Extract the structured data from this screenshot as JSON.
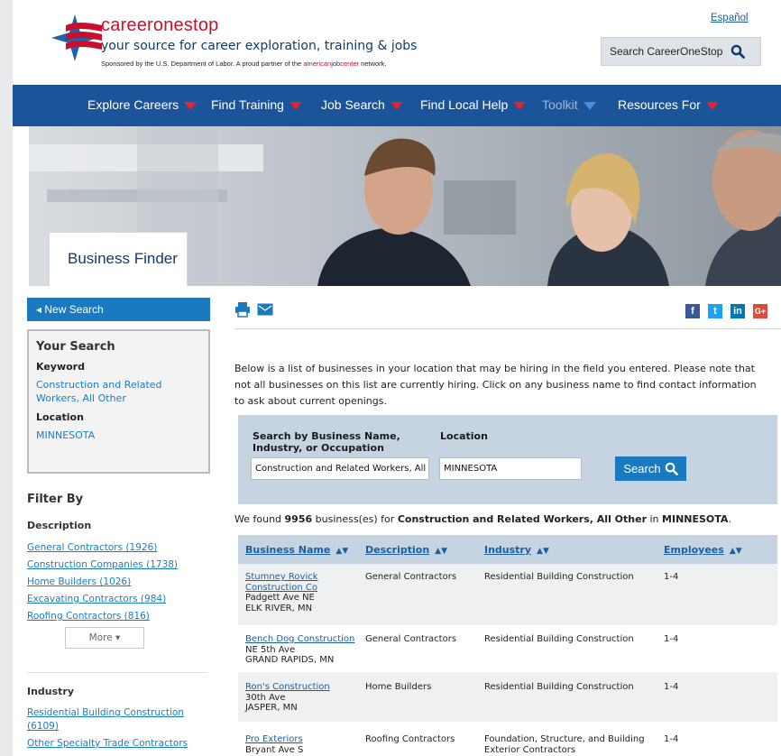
{
  "header": {
    "language_link": "Español",
    "brand_part1": "career",
    "brand_part2": "onestop",
    "tagline": "your source for career exploration, training & jobs",
    "sponsor_prefix": "Sponsored by the U.S. Department of Labor. A proud partner of the",
    "sponsor_partner_1": "american",
    "sponsor_partner_2": "job",
    "sponsor_partner_3": "center",
    "sponsor_suffix": "network.",
    "search_label": "Search CareerOneStop"
  },
  "nav": {
    "items": [
      {
        "label": "Explore Careers"
      },
      {
        "label": "Find Training"
      },
      {
        "label": "Job Search"
      },
      {
        "label": "Find Local Help"
      },
      {
        "label": "Toolkit"
      },
      {
        "label": "Resources For"
      }
    ]
  },
  "hero": {
    "title": "Business Finder"
  },
  "sidebar": {
    "new_search": "New Search",
    "your_search_title": "Your Search",
    "keyword_label": "Keyword",
    "keyword_value": "Construction and Related Workers, All Other",
    "location_label": "Location",
    "location_value": "MINNESOTA",
    "filter_title": "Filter By",
    "description_label": "Description",
    "description_filters": [
      "General Contractors (1926)",
      "Construction Companies (1738)",
      "Home Builders (1026)",
      "Excavating Contractors (984)",
      "Roofing Contractors (816)"
    ],
    "more_label": "More ▾",
    "industry_label": "Industry",
    "industry_filters": [
      "Residential Building Construction (6109)",
      "Other Specialty Trade Contractors"
    ]
  },
  "main": {
    "intro": "Below is a list of businesses in your location that may be hiring in the field you entered. Please note that not all businesses on this list are currently hiring. Click on any business name to find contact information to ask about current openings.",
    "search_name_label": "Search by Business Name, Industry, or Occupation",
    "search_location_label": "Location",
    "search_name_value": "Construction and Related Workers, All O",
    "search_location_value": "MINNESOTA",
    "search_button": "Search",
    "found_prefix": "We found",
    "found_count": "9956",
    "found_middle": "business(es) for",
    "found_keyword": "Construction and Related Workers, All Other",
    "found_in": "in",
    "found_location": "MINNESOTA",
    "found_end": "."
  },
  "table": {
    "headers": [
      "Business Name",
      "Description",
      "Industry",
      "Employees"
    ],
    "rows": [
      {
        "name": "Stumney Rovick Construction Co",
        "street": "Padgett Ave NE",
        "city": "ELK RIVER, MN",
        "description": "General Contractors",
        "industry": "Residential Building Construction",
        "employees": "1-4"
      },
      {
        "name": "Bench Dog Construction",
        "street": "NE 5th Ave",
        "city": "GRAND RAPIDS, MN",
        "description": "General Contractors",
        "industry": "Residential Building Construction",
        "employees": "1-4"
      },
      {
        "name": "Ron's Construction",
        "street": "30th Ave",
        "city": "JASPER, MN",
        "description": "Home Builders",
        "industry": "Residential Building Construction",
        "employees": "1-4"
      },
      {
        "name": "Pro Exteriors",
        "street": "Bryant Ave S",
        "city": "",
        "description": "Roofing Contractors",
        "industry": "Foundation, Structure, and Building Exterior Contractors",
        "employees": "1-4"
      }
    ]
  },
  "colors": {
    "brand_red": "#c8102e",
    "nav_blue": "#1b5499",
    "link_blue": "#1a7dc3",
    "panel": "#c5d4e0"
  },
  "social": [
    "f",
    "t",
    "in",
    "G+"
  ]
}
